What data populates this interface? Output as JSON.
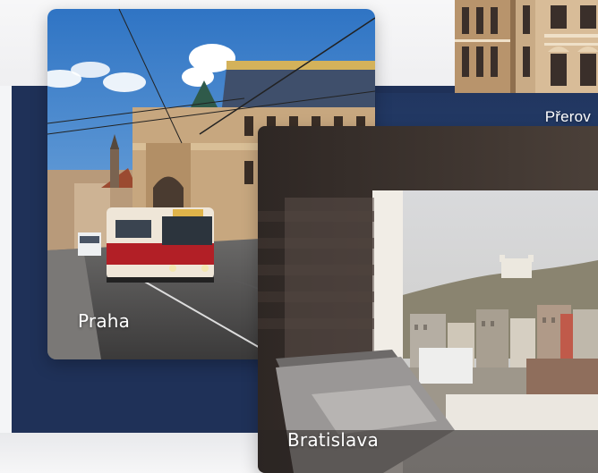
{
  "cities": [
    {
      "id": "prerov",
      "name": "Přerov"
    },
    {
      "id": "praha",
      "name": "Praha"
    },
    {
      "id": "bratislava",
      "name": "Bratislava"
    }
  ],
  "colors": {
    "panel": "#1f3158",
    "band": "#233a66",
    "label": "#ffffff"
  }
}
